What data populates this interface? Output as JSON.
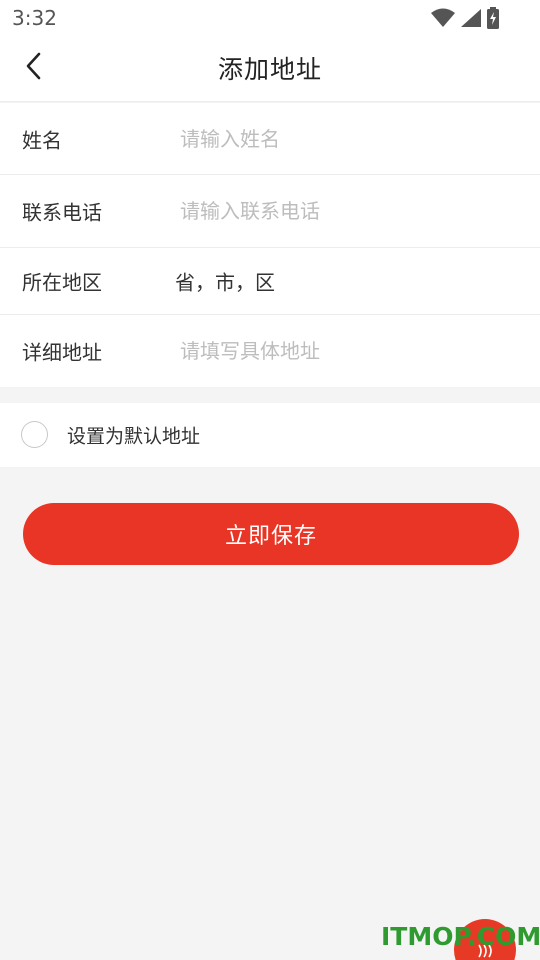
{
  "status_bar": {
    "time": "3:32",
    "icons": [
      "wifi-icon",
      "signal-icon",
      "battery-charging-icon"
    ]
  },
  "header": {
    "back_icon": "chevron-left-icon",
    "title": "添加地址"
  },
  "form": {
    "name": {
      "label": "姓名",
      "placeholder": "请输入姓名",
      "value": ""
    },
    "phone": {
      "label": "联系电话",
      "placeholder": "请输入联系电话",
      "value": ""
    },
    "region": {
      "label": "所在地区",
      "value": "省，市，区"
    },
    "detail": {
      "label": "详细地址",
      "placeholder": "请填写具体地址",
      "value": ""
    }
  },
  "default_address": {
    "label": "设置为默认地址",
    "checked": false
  },
  "save_button": {
    "label": "立即保存"
  },
  "watermark": {
    "text": "ITMOP.COM"
  },
  "colors": {
    "accent": "#e93525",
    "background": "#f4f4f4",
    "card": "#ffffff",
    "text": "#333333",
    "placeholder": "#bdbdbd",
    "watermark": "#2f9a2f"
  }
}
